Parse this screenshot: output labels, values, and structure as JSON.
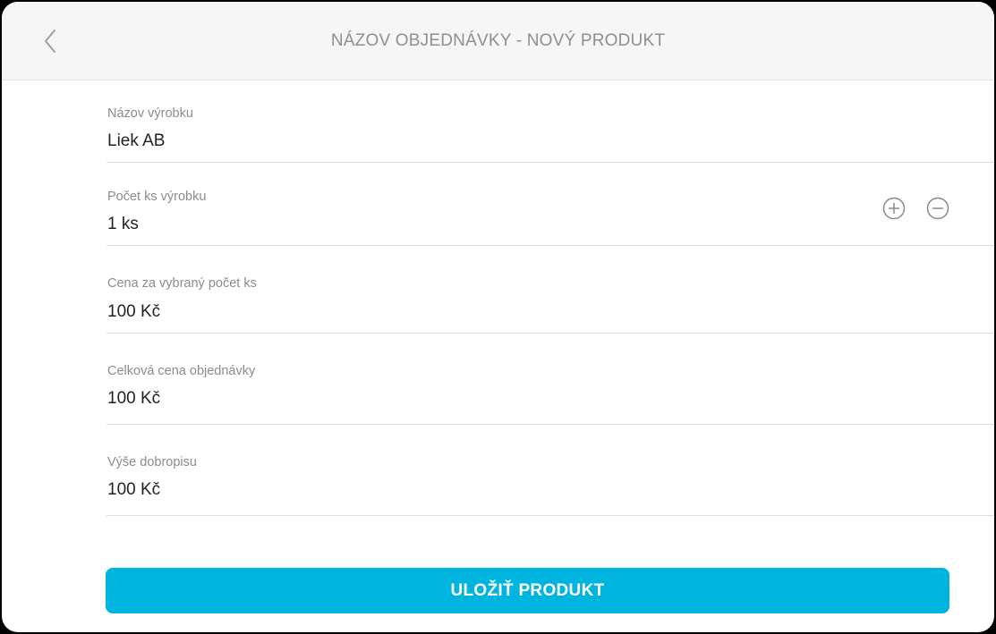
{
  "header": {
    "title": "NÁZOV OBJEDNÁVKY - NOVÝ PRODUKT",
    "back_icon": "chevron-left-icon"
  },
  "fields": {
    "product_name": {
      "label": "Názov výrobku",
      "value": "Liek AB"
    },
    "quantity": {
      "label": "Počet ks výrobku",
      "value": "1 ks",
      "increment_icon": "plus-circle-icon",
      "decrement_icon": "minus-circle-icon"
    },
    "price_selected": {
      "label": "Cena za vybraný počet ks",
      "value": "100 Kč"
    },
    "order_total": {
      "label": "Celková cena objednávky",
      "value": "100 Kč"
    },
    "credit_note": {
      "label": "Výše dobropisu",
      "value": "100 Kč"
    }
  },
  "actions": {
    "save_label": "ULOŽIŤ PRODUKT"
  },
  "colors": {
    "accent": "#00b4e0",
    "header_bg": "#f6f6f6",
    "label_text": "#8c8c8c",
    "value_text": "#222222",
    "divider": "#dedede"
  }
}
